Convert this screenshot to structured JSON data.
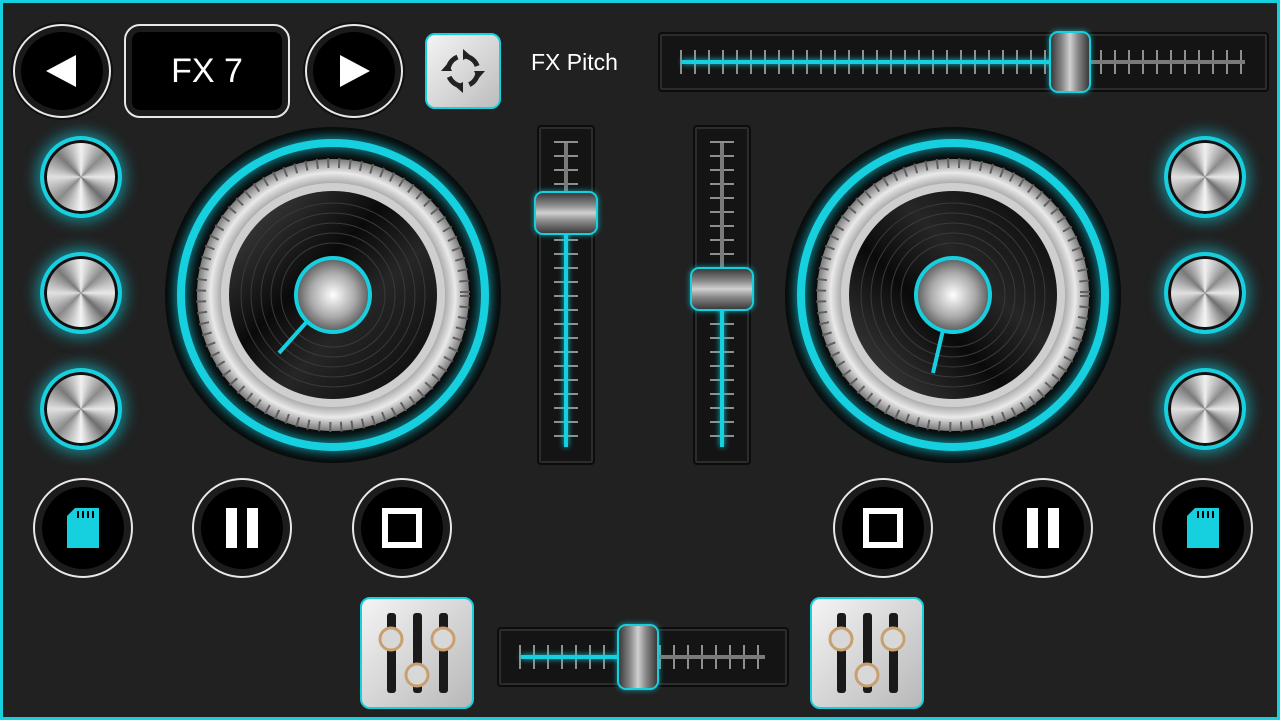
{
  "app": {
    "accent": "#16d0e0",
    "background": "#212121"
  },
  "header": {
    "prev_icon": "triangle-left-icon",
    "next_icon": "triangle-right-icon",
    "effect_name": "FX 7",
    "sync_icon": "circular-arrows-icon",
    "fx_pitch_label": "FX Pitch",
    "fx_pitch_value": 0.69
  },
  "left_deck": {
    "knobs": [
      "effect-knob-1",
      "effect-knob-2",
      "effect-knob-3"
    ],
    "volume_value": 0.77,
    "transport": [
      {
        "name": "load-track-button",
        "icon": "sd-card-icon"
      },
      {
        "name": "pause-button",
        "icon": "pause-icon"
      },
      {
        "name": "stop-button",
        "icon": "stop-icon"
      }
    ]
  },
  "right_deck": {
    "knobs": [
      "effect-knob-1",
      "effect-knob-2",
      "effect-knob-3"
    ],
    "volume_value": 0.52,
    "transport": [
      {
        "name": "stop-button",
        "icon": "stop-icon"
      },
      {
        "name": "pause-button",
        "icon": "pause-icon"
      },
      {
        "name": "load-track-button",
        "icon": "sd-card-icon"
      }
    ]
  },
  "mixer": {
    "crossfader_value": 0.48,
    "left_eq_icon": "equalizer-sliders-icon",
    "right_eq_icon": "equalizer-sliders-icon"
  }
}
